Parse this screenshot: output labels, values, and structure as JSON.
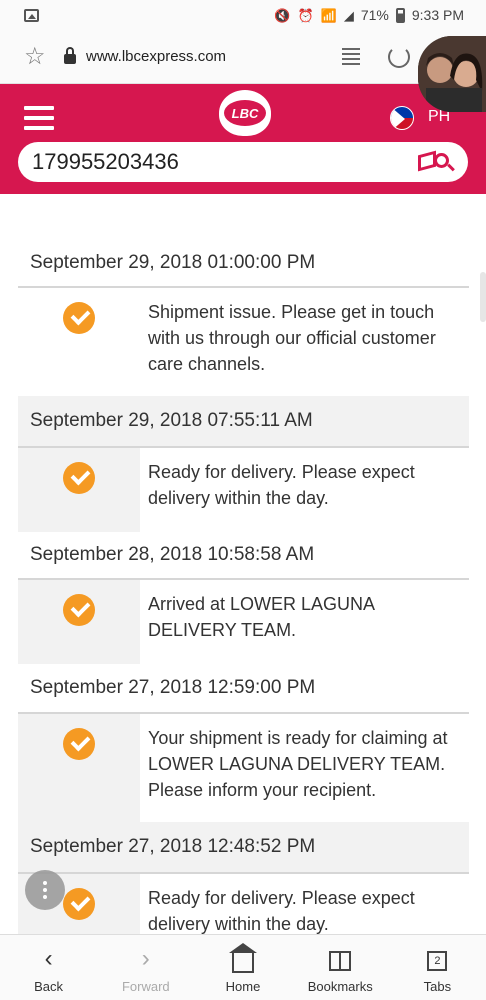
{
  "status_bar": {
    "battery": "71%",
    "time": "9:33 PM"
  },
  "browser": {
    "url": "www.lbcexpress.com"
  },
  "header": {
    "logo_text": "LBC",
    "region": "PH"
  },
  "search": {
    "value": "179955203436"
  },
  "colors": {
    "brand": "#d6174f",
    "check": "#f59a23",
    "alt_row": "#f2f2f2"
  },
  "timeline": [
    {
      "date": "September 29, 2018 01:00:00 PM",
      "status": "Shipment issue. Please get in touch with us through our official customer care channels.",
      "icon": "check-icon"
    },
    {
      "date": "September 29, 2018 07:55:11 AM",
      "status": "Ready for delivery. Please expect delivery within the day.",
      "icon": "check-icon"
    },
    {
      "date": "September 28, 2018 10:58:58 AM",
      "status": "Arrived at LOWER LAGUNA DELIVERY TEAM.",
      "icon": "check-icon"
    },
    {
      "date": "September 27, 2018 12:59:00 PM",
      "status": "Your shipment is ready for claiming at LOWER LAGUNA DELIVERY TEAM. Please inform your recipient.",
      "icon": "check-icon"
    },
    {
      "date": "September 27, 2018 12:48:52 PM",
      "status": "Ready for delivery. Please expect delivery within the day.",
      "icon": "check-icon"
    }
  ],
  "bottom_nav": {
    "back": "Back",
    "forward": "Forward",
    "home": "Home",
    "bookmarks": "Bookmarks",
    "tabs": "Tabs",
    "tab_count": "2"
  }
}
